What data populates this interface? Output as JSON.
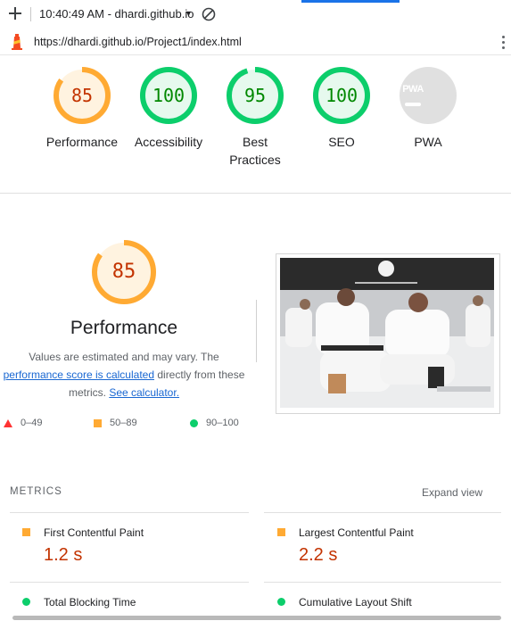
{
  "toolbar": {
    "time_host": "10:40:49 AM - dhardi.github.io",
    "url": "https://dhardi.github.io/Project1/index.html"
  },
  "gauges": [
    {
      "score": "85",
      "label": "Performance",
      "status": "average"
    },
    {
      "score": "100",
      "label": "Accessibility",
      "status": "pass"
    },
    {
      "score": "95",
      "label": "Best Practices",
      "status": "pass"
    },
    {
      "score": "100",
      "label": "SEO",
      "status": "pass"
    },
    {
      "score": "",
      "label": "PWA",
      "status": "na",
      "badge": "PWA"
    }
  ],
  "performance": {
    "score": "85",
    "title": "Performance",
    "desc_1": "Values are estimated and may vary. The",
    "link_1": "performance score is calculated",
    "desc_2": " directly from these metrics. ",
    "link_2": "See calculator."
  },
  "legend": [
    {
      "range": "0–49",
      "shape": "triangle",
      "color": "#ff3333"
    },
    {
      "range": "50–89",
      "shape": "square",
      "color": "#ffaa33"
    },
    {
      "range": "90–100",
      "shape": "circle",
      "color": "#0cce6b"
    }
  ],
  "metrics": {
    "heading": "METRICS",
    "expand_label": "Expand view",
    "items": [
      {
        "label": "First Contentful Paint",
        "value": "1.2 s",
        "status": "average"
      },
      {
        "label": "Largest Contentful Paint",
        "value": "2.2 s",
        "status": "average"
      },
      {
        "label": "Total Blocking Time",
        "value": "",
        "status": "pass"
      },
      {
        "label": "Cumulative Layout Shift",
        "value": "",
        "status": "pass"
      }
    ]
  },
  "colors": {
    "average": "#ffaa33",
    "average_text": "#c33300",
    "pass": "#0cce6b",
    "pass_text": "#008800",
    "na": "#e0e0e0",
    "link": "#1967d2"
  }
}
